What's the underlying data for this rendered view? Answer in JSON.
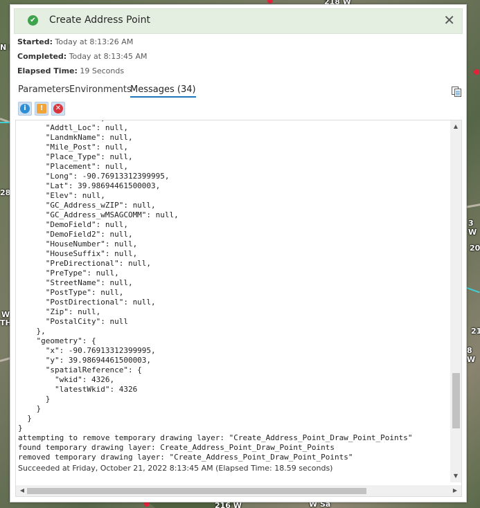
{
  "tool": {
    "title": "Create Address Point",
    "status_icon": "success-check-icon",
    "close_glyph": "✕"
  },
  "meta": {
    "started_label": "Started:",
    "started_value": "Today at 8:13:26 AM",
    "completed_label": "Completed:",
    "completed_value": "Today at 8:13:45 AM",
    "elapsed_label": "Elapsed Time:",
    "elapsed_value": "19 Seconds"
  },
  "tabs": {
    "parameters": "Parameters",
    "environments": "Environments",
    "messages": "Messages (34)",
    "active": "Messages (34)"
  },
  "filters": {
    "info": "i",
    "warning": "!",
    "error": "✕"
  },
  "messages": {
    "lines": [
      "      \"Seat\": null,",
      "      \"Addtl_Loc\": null,",
      "      \"LandmkName\": null,",
      "      \"Mile_Post\": null,",
      "      \"Place_Type\": null,",
      "      \"Placement\": null,",
      "      \"Long\": -90.76913312399995,",
      "      \"Lat\": 39.98694461500003,",
      "      \"Elev\": null,",
      "      \"GC_Address_wZIP\": null,",
      "      \"GC_Address_wMSAGCOMM\": null,",
      "      \"DemoField\": null,",
      "      \"DemoField2\": null,",
      "      \"HouseNumber\": null,",
      "      \"HouseSuffix\": null,",
      "      \"PreDirectional\": null,",
      "      \"PreType\": null,",
      "      \"StreetName\": null,",
      "      \"PostType\": null,",
      "      \"PostDirectional\": null,",
      "      \"Zip\": null,",
      "      \"PostalCity\": null",
      "    },",
      "    \"geometry\": {",
      "      \"x\": -90.76913312399995,",
      "      \"y\": 39.98694461500003,",
      "      \"spatialReference\": {",
      "        \"wkid\": 4326,",
      "        \"latestWkid\": 4326",
      "      }",
      "    }",
      "  }",
      "}",
      "attempting to remove temporary drawing layer: \"Create_Address_Point_Draw_Point_Points\"",
      "found temporary drawing layer: Create_Address_Point_Draw_Point_Points",
      "removed temporary drawing layer: \"Create_Address_Point_Draw_Point_Points\""
    ],
    "final": "Succeeded at Friday, October 21, 2022 8:13:45 AM (Elapsed Time: 18.59 seconds)"
  },
  "map_labels": {
    "a": "218 W",
    "b": "N S",
    "c": "28",
    "d": "3 W",
    "e": "20",
    "f": "W",
    "g": "TH",
    "h": "21",
    "i": "8 W",
    "j": "216 W",
    "k": "W Sa"
  },
  "scroll": {
    "vertical_fraction": 0.85,
    "horizontal_fraction": 0.0
  }
}
